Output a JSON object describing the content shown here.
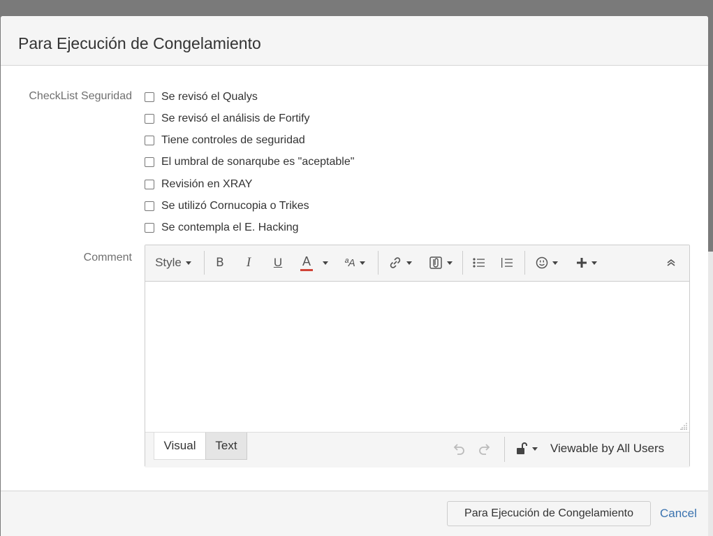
{
  "dialog": {
    "title": "Para Ejecución de Congelamiento"
  },
  "checklist": {
    "label": "CheckList Seguridad",
    "items": [
      {
        "label": "Se revisó el Qualys",
        "checked": false
      },
      {
        "label": "Se revisó el análisis de Fortify",
        "checked": false
      },
      {
        "label": "Tiene controles de seguridad",
        "checked": false
      },
      {
        "label": "El umbral de sonarqube es \"aceptable\"",
        "checked": false
      },
      {
        "label": "Revisión en XRAY",
        "checked": false
      },
      {
        "label": "Se utilizó Cornucopia o Trikes",
        "checked": false
      },
      {
        "label": "Se contempla el E. Hacking",
        "checked": false
      }
    ]
  },
  "comment": {
    "label": "Comment",
    "toolbar": {
      "style_label": "Style",
      "bold": "B",
      "italic": "I",
      "underline": "U",
      "text_color": "A",
      "font_size_label": "ªA"
    },
    "tabs": [
      {
        "label": "Visual",
        "active": true
      },
      {
        "label": "Text",
        "active": false
      }
    ],
    "visibility": "Viewable by All Users"
  },
  "footer": {
    "submit_label": "Para Ejecución de Congelamiento",
    "cancel_label": "Cancel"
  },
  "colors": {
    "link": "#3b73af",
    "underline_red": "#d04437",
    "overlay": "#7a7a7a"
  }
}
